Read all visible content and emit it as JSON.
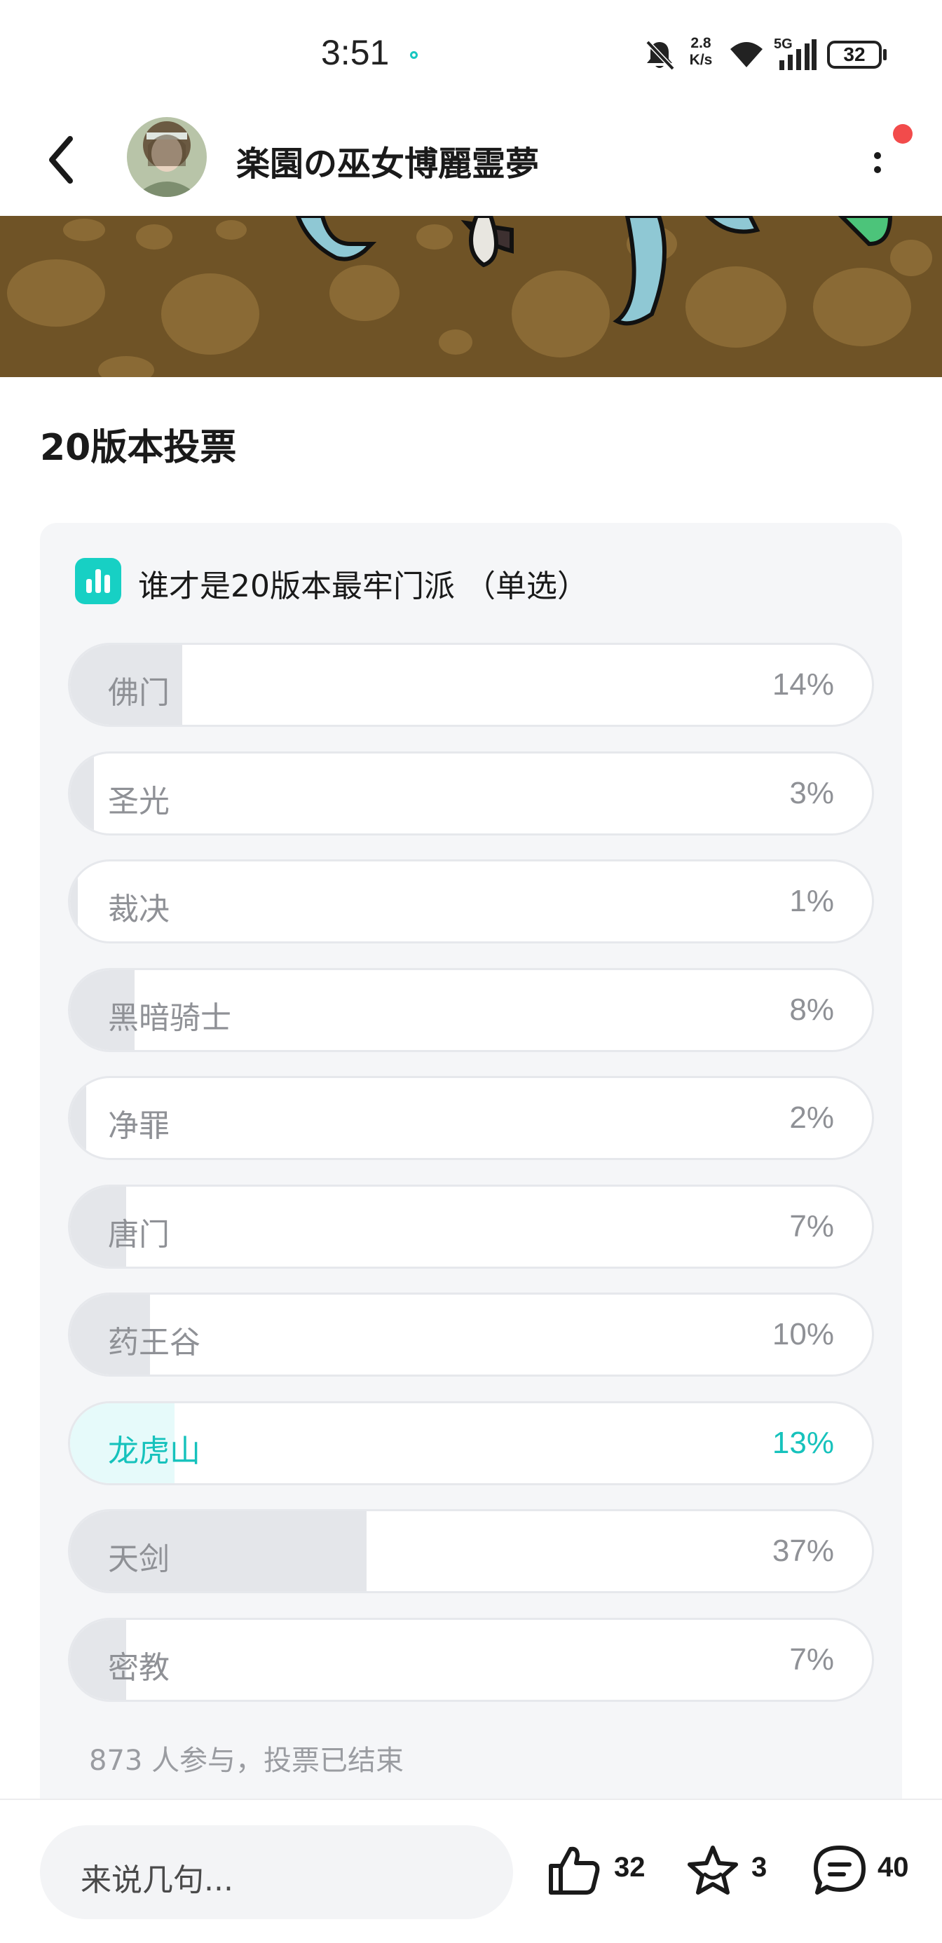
{
  "status_bar": {
    "time": "3:51",
    "net_speed_value": "2.8",
    "net_speed_unit": "K/s",
    "network": "5G",
    "battery": "32",
    "icons": [
      "notifications-off-icon",
      "wifi-icon",
      "signal-icon",
      "battery-icon"
    ]
  },
  "header": {
    "title": "楽園の巫女博麗霊夢",
    "back_icon": "chevron-left-icon",
    "more_icon": "more-vertical-icon",
    "has_notification_dot": true
  },
  "post": {
    "title": "20版本投票"
  },
  "poll": {
    "icon": "bar-chart-icon",
    "question": "谁才是20版本最牢门派 （单选）",
    "options": [
      {
        "label": "佛门",
        "percent": "14%",
        "fill": 0.14,
        "selected": false
      },
      {
        "label": "圣光",
        "percent": "3%",
        "fill": 0.03,
        "selected": false
      },
      {
        "label": "裁决",
        "percent": "1%",
        "fill": 0.01,
        "selected": false
      },
      {
        "label": "黑暗骑士",
        "percent": "8%",
        "fill": 0.08,
        "selected": false
      },
      {
        "label": "净罪",
        "percent": "2%",
        "fill": 0.02,
        "selected": false
      },
      {
        "label": "唐门",
        "percent": "7%",
        "fill": 0.07,
        "selected": false
      },
      {
        "label": "药王谷",
        "percent": "10%",
        "fill": 0.1,
        "selected": false
      },
      {
        "label": "龙虎山",
        "percent": "13%",
        "fill": 0.13,
        "selected": true
      },
      {
        "label": "天剑",
        "percent": "37%",
        "fill": 0.37,
        "selected": false
      },
      {
        "label": "密教",
        "percent": "7%",
        "fill": 0.07,
        "selected": false
      }
    ],
    "footer": "873 人参与，投票已结束"
  },
  "bottom_bar": {
    "comment_placeholder": "来说几句...",
    "likes": "32",
    "favorites": "3",
    "comments": "40",
    "like_icon": "thumbs-up-icon",
    "favorite_icon": "star-icon",
    "comment_icon": "comment-icon"
  },
  "colors": {
    "accent": "#17d0c4",
    "selected_text": "#16c2bc",
    "option_fill": "#e4e6ea",
    "card_background": "#f5f6f8",
    "notification_dot": "#f24b4b"
  }
}
